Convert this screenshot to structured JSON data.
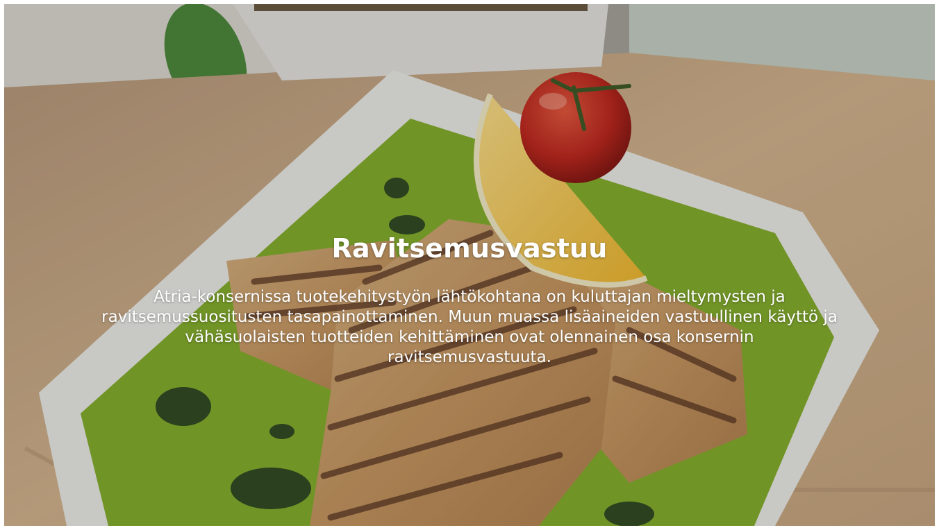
{
  "hero": {
    "title": "Ravitsemusvastuu",
    "text": "Atria-konsernissa tuotekehitystyön lähtökohtana on kuluttajan mieltymysten ja ravitsemussuositusten tasapainottaminen. Muun muassa lisäaineiden vastuullinen käyttö ja vähäsuolaisten tuotteiden kehittäminen ovat olennainen osa konsernin ravitsemusvastuuta.",
    "image": "grilled-chicken-with-lemon-and-tomato-on-green-plate",
    "colors": {
      "text": "#ffffff",
      "plate_green": "#86b02a",
      "tray_wood": "#d8b992"
    }
  }
}
